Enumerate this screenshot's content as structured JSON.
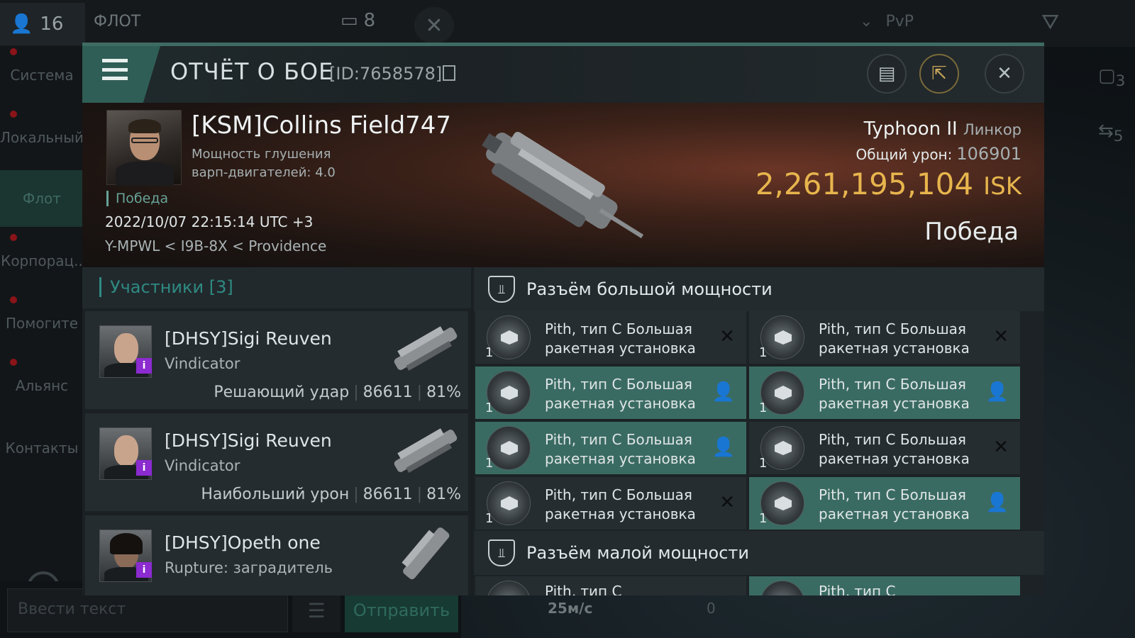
{
  "background": {
    "online_count": "16",
    "fleet_tab": "ФЛОТ",
    "fleet_count": "8",
    "filter_label": "PvP",
    "sidebar": [
      "Система",
      "Локальный",
      "Флот",
      "Корпорац..",
      "Помогите",
      "Альянс",
      "Контакты"
    ],
    "chat_placeholder": "Ввести текст",
    "send_label": "Отправить",
    "speed": "25м/с",
    "speed_zero": "0",
    "right_counts": [
      "3",
      "5"
    ]
  },
  "header": {
    "title": "ОТЧЁТ О БОЕ",
    "report_id": "[ID:7658578]"
  },
  "victim": {
    "name": "[KSM]Collins Field747",
    "stat": "Мощность глушения\nварп-двигателей: 4.0",
    "result_tag": "Победа",
    "datetime": "2022/10/07 22:15:14 UTC +3",
    "location": "Y-MPWL < I9B-8X < Providence",
    "ship": "Typhoon II",
    "ship_class": "Линкор",
    "damage_label": "Общий урон:",
    "damage_value": "106901",
    "isk_value": "2,261,195,104",
    "isk_unit": "ISK",
    "outcome": "Победа"
  },
  "participants": {
    "title": "Участники [3]",
    "rows": [
      {
        "name": "[DHSY]Sigi Reuven",
        "ship": "Vindicator",
        "role": "Решающий удар",
        "damage": "86611",
        "percent": "81%"
      },
      {
        "name": "[DHSY]Sigi Reuven",
        "ship": "Vindicator",
        "role": "Наибольший урон",
        "damage": "86611",
        "percent": "81%"
      },
      {
        "name": "[DHSY]Opeth one",
        "ship": "Rupture: заградитель",
        "role": "",
        "damage": "",
        "percent": ""
      }
    ]
  },
  "slots": {
    "high_title": "Разъём большой мощности",
    "low_title": "Разъём малой мощности",
    "high_modules": [
      {
        "name": "Pith, тип C Большая ракетная установка",
        "qty": "1",
        "state": "destroyed"
      },
      {
        "name": "Pith, тип C Большая ракетная установка",
        "qty": "1",
        "state": "destroyed"
      },
      {
        "name": "Pith, тип C Большая ракетная установка",
        "qty": "1",
        "state": "dropped"
      },
      {
        "name": "Pith, тип C Большая ракетная установка",
        "qty": "1",
        "state": "dropped"
      },
      {
        "name": "Pith, тип C Большая ракетная установка",
        "qty": "1",
        "state": "dropped"
      },
      {
        "name": "Pith, тип C Большая ракетная установка",
        "qty": "1",
        "state": "destroyed"
      },
      {
        "name": "Pith, тип C Большая ракетная установка",
        "qty": "1",
        "state": "destroyed"
      },
      {
        "name": "Pith, тип C Большая ракетная установка",
        "qty": "1",
        "state": "dropped"
      }
    ],
    "low_partial": [
      "Pith, тип C",
      "Pith, тип C"
    ]
  }
}
